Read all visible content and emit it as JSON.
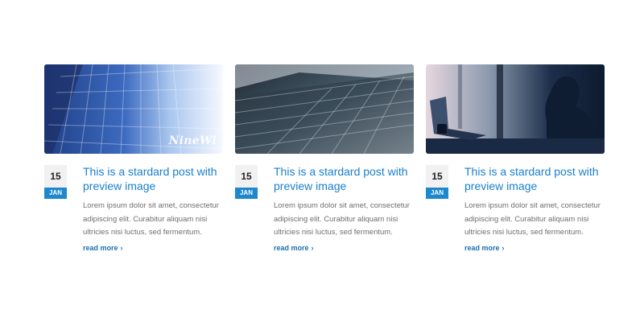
{
  "posts": [
    {
      "image_alt": "glass skyscraper facade",
      "watermark": "NineWi",
      "day": "15",
      "month": "JAN",
      "title": "This is a stardard post with preview image",
      "excerpt": "Lorem ipsum dolor sit amet, consectetur adipiscing elit. Curabitur aliquam nisi ultricies nisi luctus, sed fermentum.",
      "read_more": "read more"
    },
    {
      "image_alt": "building looking up",
      "day": "15",
      "month": "JAN",
      "title": "This is a stardard post with preview image",
      "excerpt": "Lorem ipsum dolor sit amet, consectetur adipiscing elit. Curabitur aliquam nisi ultricies nisi luctus, sed fermentum.",
      "read_more": "read more"
    },
    {
      "image_alt": "person at laptop silhouette",
      "day": "15",
      "month": "JAN",
      "title": "This is a stardard post with preview image",
      "excerpt": "Lorem ipsum dolor sit amet, consectetur adipiscing elit. Curabitur aliquam nisi ultricies nisi luctus, sed fermentum.",
      "read_more": "read more"
    }
  ],
  "colors": {
    "accent": "#1e88cf",
    "title": "#1a7fcc",
    "text": "#6f6f6f"
  },
  "icons": {
    "read_more": "chevron-right-icon"
  }
}
